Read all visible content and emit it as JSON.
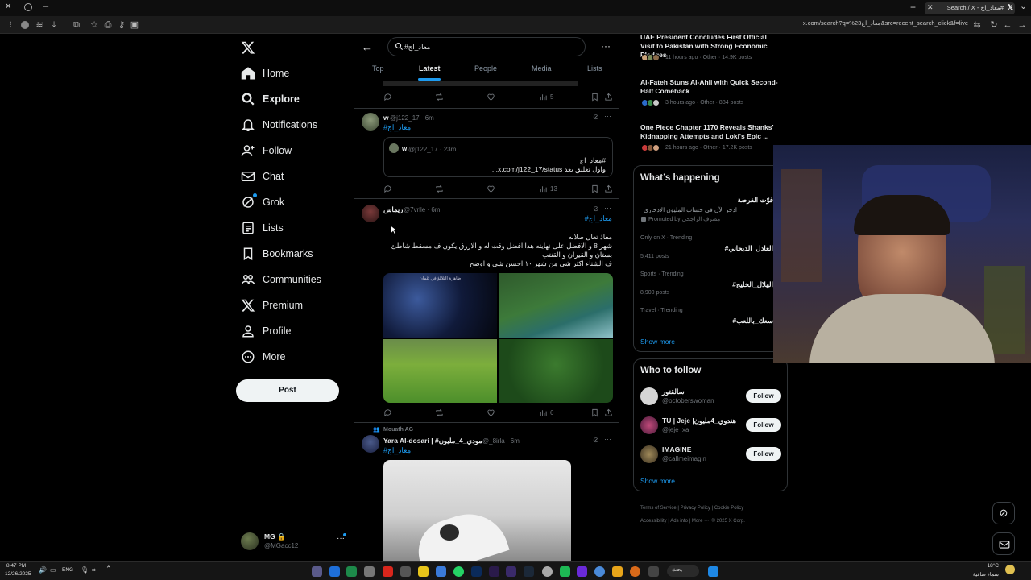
{
  "browser": {
    "tab_title": "Search / X - معاد_اج#",
    "url": "x.com/search?q=%23معاد_اج&src=recent_search_click&f=live"
  },
  "nav": {
    "items": [
      {
        "label": "Home",
        "icon": "home-icon"
      },
      {
        "label": "Explore",
        "icon": "search-icon"
      },
      {
        "label": "Notifications",
        "icon": "bell-icon"
      },
      {
        "label": "Follow",
        "icon": "person-plus-icon"
      },
      {
        "label": "Chat",
        "icon": "envelope-icon"
      },
      {
        "label": "Grok",
        "icon": "grok-icon"
      },
      {
        "label": "Lists",
        "icon": "list-icon"
      },
      {
        "label": "Bookmarks",
        "icon": "bookmark-icon"
      },
      {
        "label": "Communities",
        "icon": "communities-icon"
      },
      {
        "label": "Premium",
        "icon": "x-logo-icon"
      },
      {
        "label": "Profile",
        "icon": "person-icon"
      },
      {
        "label": "More",
        "icon": "more-circle-icon"
      }
    ],
    "post_button": "Post",
    "account": {
      "name": "MG 🔒",
      "handle": "@MGacc12"
    }
  },
  "search": {
    "query": "#معاد_اج",
    "tabs": [
      "Top",
      "Latest",
      "People",
      "Media",
      "Lists"
    ],
    "active_tab": "Latest"
  },
  "tweets": [
    {
      "views": "5"
    },
    {
      "name": "w",
      "handle": "@j122_17 · 6m",
      "hashtag": "#معاد_اج",
      "quote": {
        "name": "w",
        "handle": "@j122_17 · 23m",
        "line1": "#معاد_اج",
        "line2": "واول تعليق بعد x.com/j122_17/status..."
      },
      "views": "13"
    },
    {
      "name": "ريماس",
      "handle": "@7vrlle · 6m",
      "hashtag": "#معاد_اج",
      "lines": [
        "معاذ تعال صلاله",
        "شهر 8 و الافضل على نهايته هذا افضل وقت له و الازرق يكون ف مسقط شاطئ",
        "بستان و القيران و القنتب",
        "ف الشتاء اكثر شي من شهر ١٠ احسن شي و اوضح"
      ],
      "image_caption": "ظاهرة التلالؤ في عُمان",
      "views": "6"
    },
    {
      "community": "Mouath AG",
      "name": "Yara Al-dosari | #مودي_4_مليون",
      "handle": "@_8irla · 6m",
      "hashtag": "#معاد_اج"
    }
  ],
  "news": [
    {
      "title": "UAE President Concludes First Official Visit to Pakistan with Strong Economic Pledges",
      "meta": "11 hours ago · Other · 14.9K posts"
    },
    {
      "title": "Al-Fateh Stuns Al-Ahli with Quick Second-Half Comeback",
      "meta": "3 hours ago · Other · 884 posts"
    },
    {
      "title": "One Piece Chapter 1170 Reveals Shanks' Kidnapping Attempts and Loki's Epic ...",
      "meta": "21 hours ago · Other · 17.2K posts"
    }
  ],
  "happening": {
    "title": "What’s happening",
    "items": [
      {
        "name": "فوّت الفرصة",
        "desc": "ادخر الآن في حساب المليون الادخاري",
        "promo": "Promoted by مصرف الراجحي"
      },
      {
        "cat": "Only on X · Trending",
        "name": "#العادل_الديحاني",
        "posts": "5,411 posts"
      },
      {
        "cat": "Sports · Trending",
        "name": "#الهلال_الخليج",
        "posts": "8,900 posts"
      },
      {
        "cat": "Travel · Trending",
        "name": "#سعك_باللعب"
      }
    ],
    "show_more": "Show more"
  },
  "who_to_follow": {
    "title": "Who to follow",
    "items": [
      {
        "name": "سالقتور",
        "handle": "@octoberswoman",
        "button": "Follow"
      },
      {
        "name": "TU | Jeje |هندوي_4مليون",
        "handle": "@jeje_xa",
        "button": "Follow"
      },
      {
        "name": "IMAGINE",
        "handle": "@callmeimagin",
        "button": "Follow"
      }
    ],
    "show_more": "Show more"
  },
  "footer": {
    "links": [
      "Terms of Service",
      "Privacy Policy",
      "Cookie Policy",
      "Accessibility",
      "Ads info",
      "More ···",
      "© 2025 X Corp."
    ]
  },
  "taskbar": {
    "time": "8:47 PM",
    "date": "12/26/2025",
    "lang": "ENG",
    "weather_temp": "18°C",
    "weather_desc": "سماء صافية",
    "search_label": "بحث"
  },
  "colors": {
    "accent": "#1d9bf0",
    "bg": "#000000",
    "border": "#2f3336",
    "muted": "#71767b"
  }
}
